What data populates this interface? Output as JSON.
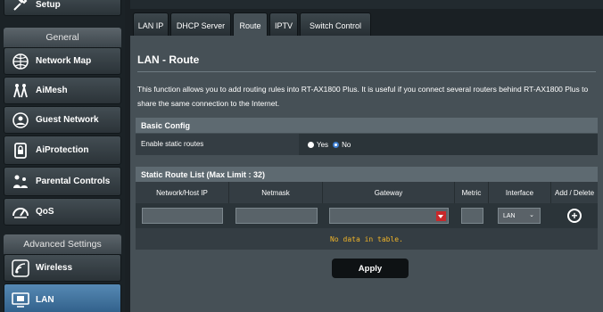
{
  "sidebar": {
    "setup_label": "Setup",
    "general_header": "General",
    "items": [
      {
        "label": "Network Map",
        "icon": "network-map-icon"
      },
      {
        "label": "AiMesh",
        "icon": "aimesh-icon"
      },
      {
        "label": "Guest Network",
        "icon": "guest-network-icon"
      },
      {
        "label": "AiProtection",
        "icon": "shield-lock-icon"
      },
      {
        "label": "Parental Controls",
        "icon": "parental-controls-icon"
      },
      {
        "label": "QoS",
        "icon": "qos-gauge-icon"
      }
    ],
    "advanced_header": "Advanced Settings",
    "advanced_items": [
      {
        "label": "Wireless",
        "icon": "wireless-icon"
      },
      {
        "label": "LAN",
        "icon": "lan-icon"
      }
    ]
  },
  "tabs": [
    "LAN IP",
    "DHCP Server",
    "Route",
    "IPTV",
    "Switch Control"
  ],
  "active_tab": "Route",
  "page": {
    "title": "LAN - Route",
    "description": "This function allows you to add routing rules into RT-AX1800 Plus. It is useful if you connect several routers behind RT-AX1800 Plus to share the same connection to the Internet."
  },
  "basic_config": {
    "header": "Basic Config",
    "enable_label": "Enable static routes",
    "yes_label": "Yes",
    "no_label": "No",
    "selected": "No"
  },
  "route_list": {
    "header": "Static Route List (Max Limit : 32)",
    "columns": [
      "Network/Host IP",
      "Netmask",
      "Gateway",
      "Metric",
      "Interface",
      "Add / Delete"
    ],
    "interface_value": "LAN",
    "empty_message": "No data in table."
  },
  "apply_label": "Apply",
  "colors": {
    "accent_blue": "#3e7ed1",
    "warning_text": "#f0b428",
    "dropdown_red": "#c8282b"
  }
}
